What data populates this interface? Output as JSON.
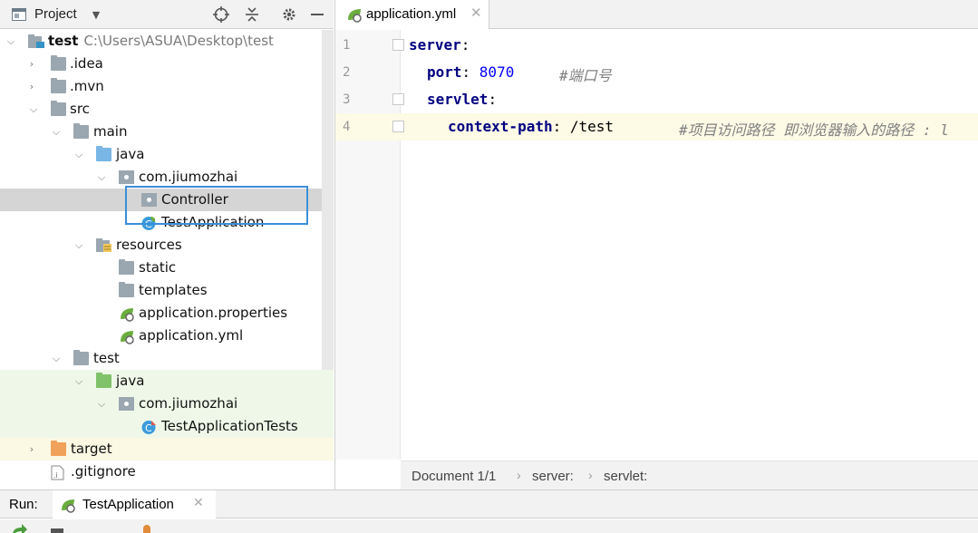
{
  "project_panel": {
    "title": "Project",
    "tree": [
      {
        "label": "test",
        "path": "C:\\Users\\ASUA\\Desktop\\test"
      },
      {
        "label": ".idea"
      },
      {
        "label": ".mvn"
      },
      {
        "label": "src"
      },
      {
        "label": "main"
      },
      {
        "label": "java"
      },
      {
        "label": "com.jiumozhai"
      },
      {
        "label": "Controller"
      },
      {
        "label": "TestApplication"
      },
      {
        "label": "resources"
      },
      {
        "label": "static"
      },
      {
        "label": "templates"
      },
      {
        "label": "application.properties"
      },
      {
        "label": "application.yml"
      },
      {
        "label": "test"
      },
      {
        "label": "java"
      },
      {
        "label": "com.jiumozhai"
      },
      {
        "label": "TestApplicationTests"
      },
      {
        "label": "target"
      },
      {
        "label": ".gitignore"
      }
    ]
  },
  "editor": {
    "tab_label": "application.yml",
    "lines": [
      {
        "num": "1",
        "key": "server",
        "sep": ":"
      },
      {
        "num": "2",
        "key": "port",
        "sep": ": ",
        "value": "8070",
        "comment": "#端口号"
      },
      {
        "num": "3",
        "key": "servlet",
        "sep": ":"
      },
      {
        "num": "4",
        "key": "context-path",
        "sep": ": ",
        "value": "/test",
        "comment": "#项目访问路径 即浏览器输入的路径 : l"
      }
    ],
    "breadcrumb": [
      "Document 1/1",
      "server:",
      "servlet:"
    ]
  },
  "run_bar": {
    "label": "Run:",
    "tab_label": "TestApplication"
  },
  "colors": {
    "selection": "#d5d5d5",
    "highlight_box": "#3b8fd9",
    "yaml_key": "#000080",
    "number": "#0000ff",
    "comment": "#808080"
  }
}
